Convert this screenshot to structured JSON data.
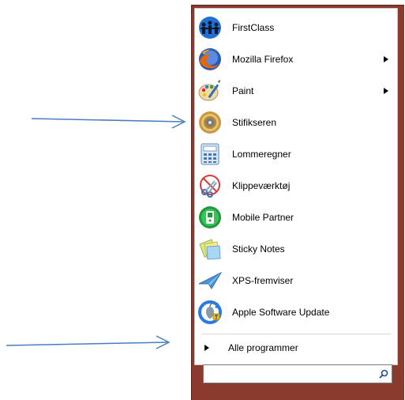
{
  "start_menu": {
    "programs": [
      {
        "label": "FirstClass",
        "icon": "firstclass-icon",
        "submenu": false
      },
      {
        "label": "Mozilla Firefox",
        "icon": "firefox-icon",
        "submenu": true
      },
      {
        "label": "Paint",
        "icon": "paint-icon",
        "submenu": true
      },
      {
        "label": "Stifikseren",
        "icon": "stifikseren-icon",
        "submenu": false
      },
      {
        "label": "Lommeregner",
        "icon": "calculator-icon",
        "submenu": false
      },
      {
        "label": "Klippeværktøj",
        "icon": "snipping-tool-icon",
        "submenu": false
      },
      {
        "label": "Mobile Partner",
        "icon": "mobile-partner-icon",
        "submenu": false
      },
      {
        "label": "Sticky Notes",
        "icon": "sticky-notes-icon",
        "submenu": false
      },
      {
        "label": "XPS-fremviser",
        "icon": "xps-viewer-icon",
        "submenu": false
      },
      {
        "label": "Apple Software Update",
        "icon": "apple-software-update-icon",
        "submenu": false
      }
    ],
    "all_programs_label": "Alle programmer",
    "search": {
      "value": "",
      "placeholder": ""
    }
  },
  "annotations": {
    "arrow_color": "#4a7ebb",
    "arrow_targets": [
      "Stifikseren",
      "Alle programmer"
    ]
  },
  "colors": {
    "frame": "#8a3b2d",
    "menu_background": "#ffffff"
  }
}
